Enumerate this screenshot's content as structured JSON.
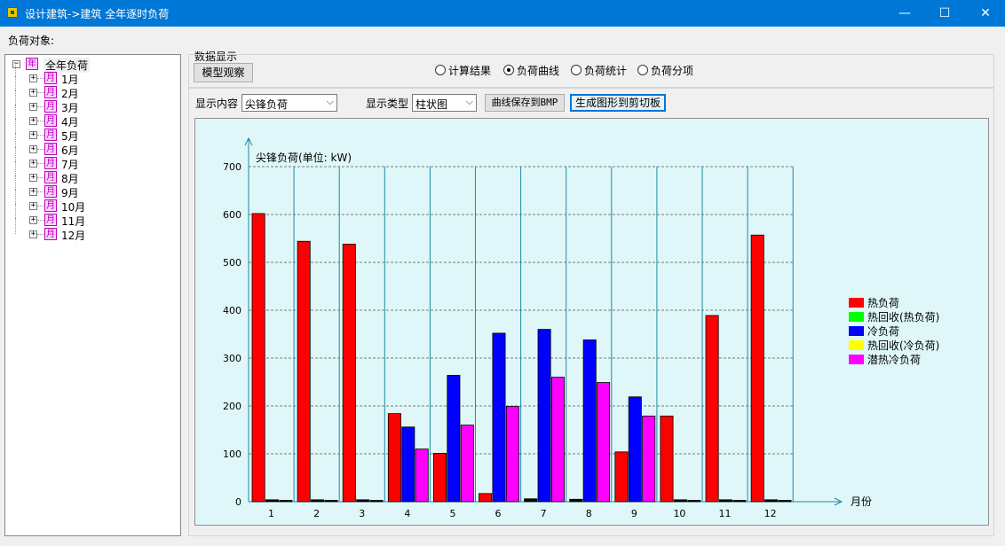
{
  "window": {
    "title": "设计建筑->建筑 全年逐时负荷",
    "minimize_glyph": "—",
    "maximize_glyph": "☐",
    "close_glyph": "✕"
  },
  "sidebar": {
    "label": "负荷对象:",
    "root": {
      "label": "全年负荷",
      "icon": "年",
      "expander": "−"
    },
    "months": [
      {
        "label": "1月",
        "icon": "月",
        "expander": "+"
      },
      {
        "label": "2月",
        "icon": "月",
        "expander": "+"
      },
      {
        "label": "3月",
        "icon": "月",
        "expander": "+"
      },
      {
        "label": "4月",
        "icon": "月",
        "expander": "+"
      },
      {
        "label": "5月",
        "icon": "月",
        "expander": "+"
      },
      {
        "label": "6月",
        "icon": "月",
        "expander": "+"
      },
      {
        "label": "7月",
        "icon": "月",
        "expander": "+"
      },
      {
        "label": "8月",
        "icon": "月",
        "expander": "+"
      },
      {
        "label": "9月",
        "icon": "月",
        "expander": "+"
      },
      {
        "label": "10月",
        "icon": "月",
        "expander": "+"
      },
      {
        "label": "11月",
        "icon": "月",
        "expander": "+"
      },
      {
        "label": "12月",
        "icon": "月",
        "expander": "+"
      }
    ]
  },
  "data_display": {
    "group_label": "数据显示",
    "model_button": "模型观察",
    "radios": [
      {
        "label": "计算结果",
        "selected": false
      },
      {
        "label": "负荷曲线",
        "selected": true
      },
      {
        "label": "负荷统计",
        "selected": false
      },
      {
        "label": "负荷分项",
        "selected": false
      }
    ]
  },
  "toolbar": {
    "content_label": "显示内容",
    "content_value": "尖锋负荷",
    "type_label": "显示类型",
    "type_value": "柱状图",
    "save_bmp_button": "曲线保存到BMP",
    "clipboard_button": "生成图形到剪切板"
  },
  "chart_data": {
    "type": "bar",
    "title": "尖锋负荷(单位: kW)",
    "xlabel": "月份",
    "ylabel": "",
    "ylim": [
      0,
      700
    ],
    "yticks": [
      0,
      100,
      200,
      300,
      400,
      500,
      600,
      700
    ],
    "categories": [
      "1",
      "2",
      "3",
      "4",
      "5",
      "6",
      "7",
      "8",
      "9",
      "10",
      "11",
      "12"
    ],
    "legend_position": "right",
    "grid": true,
    "series": [
      {
        "name": "热负荷",
        "color": "#ff0000",
        "values": [
          602,
          544,
          538,
          184,
          101,
          17,
          6,
          5,
          104,
          179,
          389,
          557
        ]
      },
      {
        "name": "热回收(热负荷)",
        "color": "#00ff00",
        "values": [
          0,
          0,
          0,
          0,
          0,
          0,
          0,
          0,
          0,
          0,
          0,
          0
        ]
      },
      {
        "name": "冷负荷",
        "color": "#0000ff",
        "values": [
          4,
          4,
          4,
          156,
          264,
          352,
          360,
          338,
          219,
          4,
          4,
          4
        ]
      },
      {
        "name": "热回收(冷负荷)",
        "color": "#ffff00",
        "values": [
          0,
          0,
          0,
          0,
          0,
          0,
          0,
          0,
          0,
          0,
          0,
          0
        ]
      },
      {
        "name": "潜热冷负荷",
        "color": "#ff00ff",
        "values": [
          2,
          2,
          2,
          110,
          160,
          199,
          260,
          249,
          179,
          2,
          2,
          2
        ]
      }
    ]
  }
}
